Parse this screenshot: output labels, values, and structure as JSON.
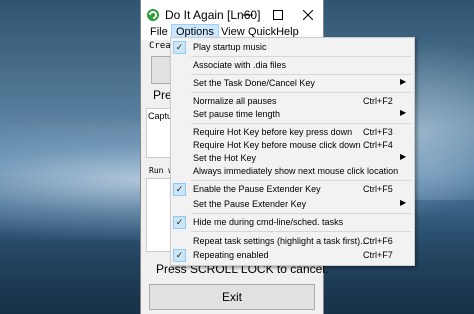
{
  "window": {
    "title": "Do It Again [Ln60]"
  },
  "menubar": [
    "File",
    "Options",
    "View",
    "QuickHelp"
  ],
  "main": {
    "create_label": "Creat",
    "press_label": "Pres",
    "capture_label": "Captur",
    "run_label": "Run w",
    "scroll_lock": "Press SCROLL LOCK to cancel.",
    "exit_label": "Exit"
  },
  "options_menu": [
    {
      "label": "Play startup music",
      "checked": true
    },
    {
      "label": "Associate with .dia files"
    },
    {
      "label": "Set the Task Done/Cancel Key",
      "submenu": true
    },
    {
      "label": "Normalize all pauses",
      "shortcut": "Ctrl+F2"
    },
    {
      "label": "Set pause time length",
      "submenu": true
    },
    {
      "label": "Require Hot Key before key press down",
      "shortcut": "Ctrl+F3"
    },
    {
      "label": "Require Hot Key before mouse click down",
      "shortcut": "Ctrl+F4"
    },
    {
      "label": "Set the Hot Key",
      "submenu": true
    },
    {
      "label": "Always immediately show next mouse click location"
    },
    {
      "label": "Enable the Pause Extender Key",
      "shortcut": "Ctrl+F5",
      "checked": true
    },
    {
      "label": "Set the Pause Extender Key",
      "submenu": true
    },
    {
      "label": "Hide me during cmd-line/sched. tasks",
      "checked": true
    },
    {
      "label": "Repeat task settings (highlight a task first)...",
      "shortcut": "Ctrl+F6"
    },
    {
      "label": "Repeating enabled",
      "shortcut": "Ctrl+F7",
      "checked": true
    }
  ],
  "icons": {
    "check": "checkmark-icon",
    "submenu": "submenu-arrow-icon"
  }
}
